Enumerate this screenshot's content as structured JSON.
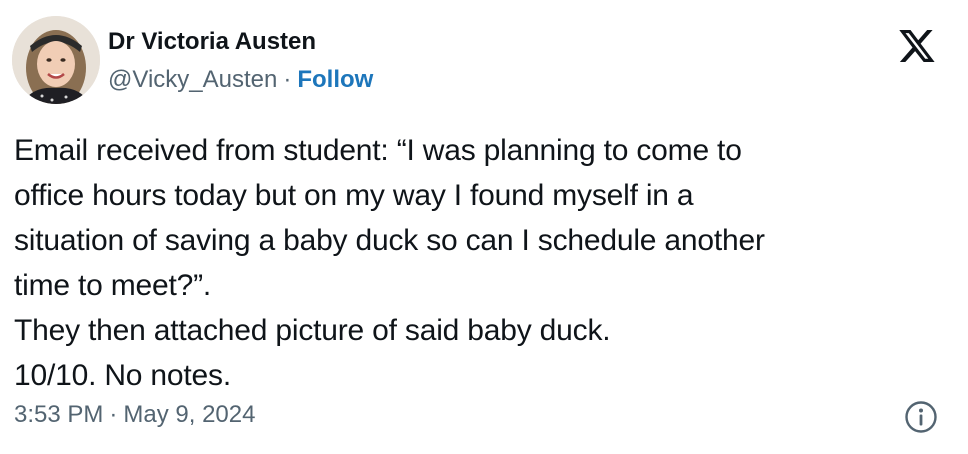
{
  "author": {
    "name": "Dr Victoria Austen",
    "handle": "@Vicky_Austen",
    "separator": "·",
    "follow_label": "Follow",
    "avatar_icon": "profile-photo-avatar"
  },
  "platform": {
    "logo_icon": "x-logo-icon"
  },
  "tweet": {
    "lines": [
      "Email received from student: “I was planning to come to",
      "office hours today but on my way I found myself in a",
      "situation of saving a baby duck so can I schedule another",
      "time to meet?”.",
      "They then attached picture of said baby duck.",
      "10/10. No notes."
    ]
  },
  "meta": {
    "time": "3:53 PM",
    "separator": "·",
    "date": "May 9, 2024",
    "info_icon": "info-icon"
  },
  "colors": {
    "text": "#0f1419",
    "secondary": "#536471",
    "follow": "#1d76bb",
    "background": "#ffffff"
  }
}
